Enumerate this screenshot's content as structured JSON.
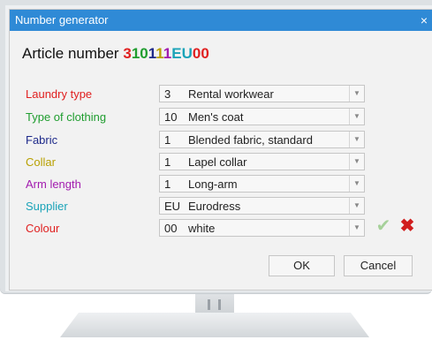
{
  "window": {
    "title": "Number generator",
    "close_glyph": "×"
  },
  "article": {
    "label": "Article number",
    "segments": [
      {
        "text": "3",
        "color": "#e02020"
      },
      {
        "text": "10",
        "color": "#1f9d2f"
      },
      {
        "text": "1",
        "color": "#1e2a8a"
      },
      {
        "text": "1",
        "color": "#b8a000"
      },
      {
        "text": "1",
        "color": "#a21caf"
      },
      {
        "text": "EU",
        "color": "#1aa3b8"
      },
      {
        "text": "00",
        "color": "#e02020"
      }
    ]
  },
  "fields": [
    {
      "label": "Laundry type",
      "color": "#e02020",
      "code": "3",
      "value": "Rental workwear"
    },
    {
      "label": "Type of clothing",
      "color": "#1f9d2f",
      "code": "10",
      "value": "Men's coat"
    },
    {
      "label": "Fabric",
      "color": "#1e2a8a",
      "code": "1",
      "value": "Blended fabric, standard"
    },
    {
      "label": "Collar",
      "color": "#b8a000",
      "code": "1",
      "value": "Lapel collar"
    },
    {
      "label": "Arm length",
      "color": "#a21caf",
      "code": "1",
      "value": "Long-arm"
    },
    {
      "label": "Supplier",
      "color": "#1aa3b8",
      "code": "EU",
      "value": "Eurodress"
    },
    {
      "label": "Colour",
      "color": "#e02020",
      "code": "00",
      "value": "white"
    }
  ],
  "icons": {
    "dropdown": "chevron-down-icon",
    "confirm": "checkmark-icon",
    "reject": "cross-icon"
  },
  "buttons": {
    "ok": "OK",
    "cancel": "Cancel"
  }
}
